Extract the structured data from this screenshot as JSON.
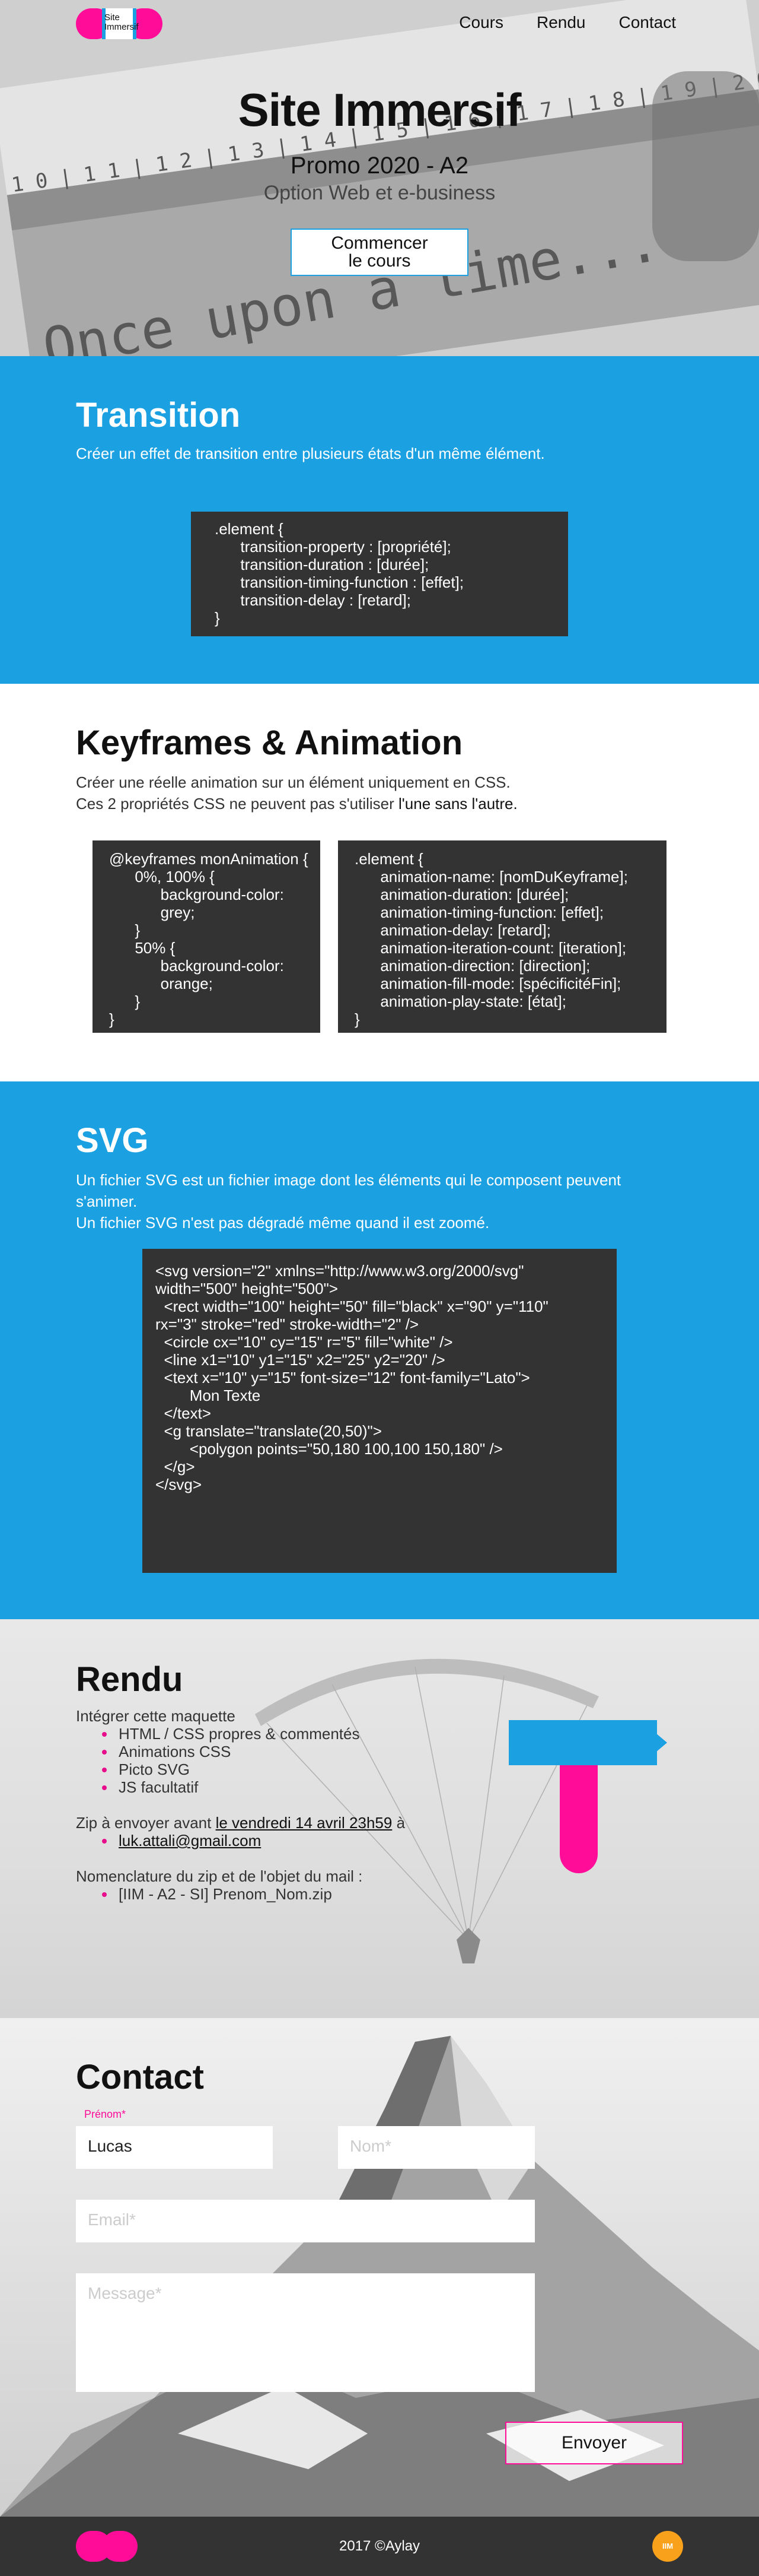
{
  "nav": {
    "logo_text": "Site\nImmersif",
    "items": [
      "Cours",
      "Rendu",
      "Contact"
    ]
  },
  "hero": {
    "title": "Site Immersif",
    "promo": "Promo 2020 - A2",
    "option": "Option Web et e-business",
    "button": "Commencer\nle cours",
    "bg_text": "Once upon a time..."
  },
  "transition": {
    "title": "Transition",
    "desc_pre": "Créer un effet de ",
    "desc_bold": "transition",
    "desc_post": " entre plusieurs états d'un même élément.",
    "code": ".element {\n      transition-property : [propriété];\n      transition-duration : [durée];\n      transition-timing-function : [effet];\n      transition-delay : [retard];\n}"
  },
  "keyframes": {
    "title": "Keyframes & Animation",
    "desc_line1": "Créer une réelle animation sur un élément uniquement en CSS.",
    "desc_line2_pre": "Ces 2 propriétés CSS ne peuvent pas s'utiliser ",
    "desc_line2_bold": "l'une sans l'autre.",
    "code1": "@keyframes monAnimation {\n      0%, 100% {\n            background-color:\n            grey;\n      }\n      50% {\n            background-color:\n            orange;\n      }\n}",
    "code2": ".element {\n      animation-name: [nomDuKeyframe];\n      animation-duration: [durée];\n      animation-timing-function: [effet];\n      animation-delay: [retard];\n      animation-iteration-count: [iteration];\n      animation-direction: [direction];\n      animation-fill-mode: [spécificitéFin];\n      animation-play-state: [état];\n}"
  },
  "svg": {
    "title": "SVG",
    "desc_line1": "Un fichier SVG est un fichier image dont les éléments qui le composent peuvent",
    "desc_line2": "s'animer.",
    "desc_line3": "Un fichier SVG n'est pas dégradé même quand il est zoomé.",
    "code": "<svg version=\"2\" xmlns=\"http://www.w3.org/2000/svg\"\nwidth=\"500\" height=\"500\">\n  <rect width=\"100\" height=\"50\" fill=\"black\" x=\"90\" y=\"110\"\nrx=\"3\" stroke=\"red\" stroke-width=\"2\" />\n  <circle cx=\"10\" cy=\"15\" r=\"5\" fill=\"white\" />\n  <line x1=\"10\" y1=\"15\" x2=\"25\" y2=\"20\" />\n  <text x=\"10\" y=\"15\" font-size=\"12\" font-family=\"Lato\">\n        Mon Texte\n  </text>\n  <g translate=\"translate(20,50)\">\n        <polygon points=\"50,180 100,100 150,180\" />\n  </g>\n</svg>"
  },
  "rendu": {
    "title": "Rendu",
    "intro": "Intégrer cette  maquette",
    "items": [
      "HTML / CSS propres & commentés",
      "Animations CSS",
      "Picto SVG",
      "JS facultatif"
    ],
    "zip_pre": "Zip à envoyer avant ",
    "zip_date": "le vendredi 14 avril 23h59",
    "zip_post": " à",
    "email": "luk.attali@gmail.com",
    "nomenclature": "Nomenclature du zip et de l'objet du mail :",
    "nomenclature_item": "[IIM - A2 - SI] Prenom_Nom.zip"
  },
  "contact": {
    "title": "Contact",
    "prenom_label": "Prénom*",
    "prenom_value": "Lucas",
    "nom_placeholder": "Nom*",
    "email_placeholder": "Email*",
    "message_placeholder": "Message*",
    "send": "Envoyer"
  },
  "footer": {
    "copyright": "2017 ©Aylay",
    "badge": "IIM"
  },
  "colors": {
    "blue": "#1ba0e2",
    "pink": "#ff0d99",
    "dark": "#333333",
    "orange": "#f9a11b"
  }
}
